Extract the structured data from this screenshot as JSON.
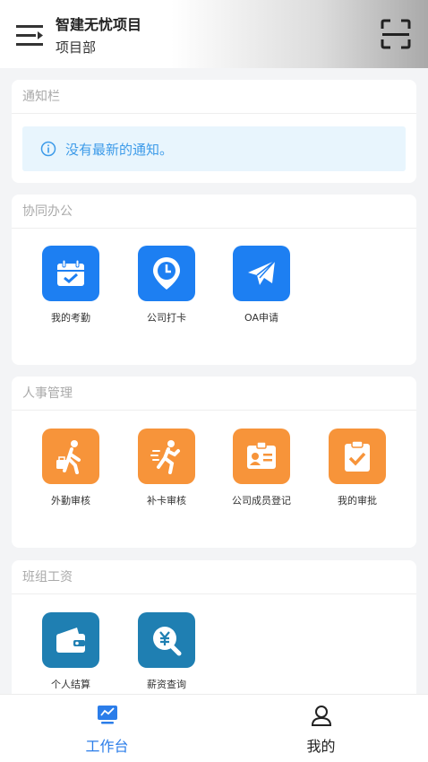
{
  "header": {
    "org_name": "智建无忧项目",
    "department": "项目部"
  },
  "notice_card": {
    "title": "通知栏",
    "message": "没有最新的通知。"
  },
  "office_card": {
    "title": "协同办公",
    "items": [
      {
        "label": "我的考勤",
        "icon": "calendar-check-icon"
      },
      {
        "label": "公司打卡",
        "icon": "clock-pin-icon"
      },
      {
        "label": "OA申请",
        "icon": "paper-plane-icon"
      }
    ]
  },
  "hr_card": {
    "title": "人事管理",
    "items": [
      {
        "label": "外勤审核",
        "icon": "walker-bag-icon"
      },
      {
        "label": "补卡审核",
        "icon": "runner-icon"
      },
      {
        "label": "公司成员登记",
        "icon": "id-card-icon"
      },
      {
        "label": "我的审批",
        "icon": "clipboard-check-icon"
      }
    ]
  },
  "salary_card": {
    "title": "班组工资",
    "items": [
      {
        "label": "个人结算",
        "icon": "wallet-icon"
      },
      {
        "label": "薪资查询",
        "icon": "yuan-search-icon"
      }
    ]
  },
  "tabbar": {
    "tabs": [
      {
        "label": "工作台",
        "active": true
      },
      {
        "label": "我的",
        "active": false
      }
    ]
  },
  "colors": {
    "blue_tile": "#1d7ff2",
    "orange_tile": "#f7943a",
    "teal_tile": "#1f7fb2",
    "active_tab": "#2b7de9"
  }
}
